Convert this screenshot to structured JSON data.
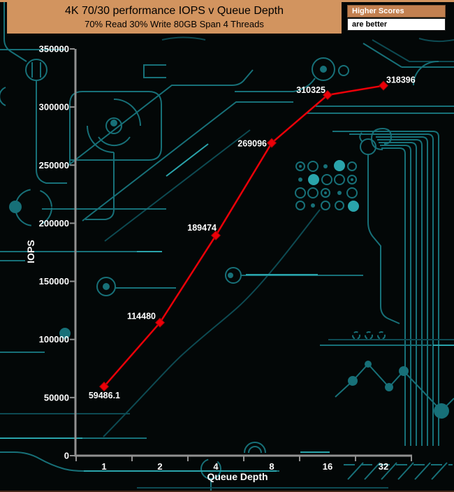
{
  "banner": {
    "title": "4K 70/30 performance IOPS v Queue Depth",
    "subtitle": "70% Read 30% Write 80GB Span 4 Threads",
    "bg_color": "#d2945f"
  },
  "note_box": {
    "header": "Higher Scores",
    "body": "are better",
    "header_bg": "#c28050",
    "body_bg": "#ffffff"
  },
  "chart_data": {
    "type": "line",
    "title": "4K 70/30 performance IOPS v Queue Depth",
    "xlabel": "Queue Depth",
    "ylabel": "IOPS",
    "categories": [
      "1",
      "2",
      "4",
      "8",
      "16",
      "32"
    ],
    "series": [
      {
        "name": "IOPS",
        "color": "#ec0008",
        "values": [
          59486.1,
          114480,
          189474,
          269096,
          310325,
          318396
        ]
      }
    ],
    "point_labels": [
      "59486.1",
      "114480",
      "189474",
      "269096",
      "310325",
      "318396"
    ],
    "yticks": [
      "0",
      "50000",
      "100000",
      "150000",
      "200000",
      "250000",
      "300000",
      "350000"
    ],
    "ylim": [
      0,
      350000
    ],
    "grid": false,
    "legend_position": "none",
    "label_offsets": [
      {
        "anchor": "end",
        "dx": 23,
        "dy": 17
      },
      {
        "anchor": "end",
        "dx": -6,
        "dy": -5
      },
      {
        "anchor": "end",
        "dx": 1,
        "dy": -7
      },
      {
        "anchor": "end",
        "dx": -7,
        "dy": 5
      },
      {
        "anchor": "end",
        "dx": -3,
        "dy": -3
      },
      {
        "anchor": "start",
        "dx": 4,
        "dy": -4
      }
    ]
  },
  "colors": {
    "background": "#030707",
    "axis": "#919191",
    "tick_label": "#ffffff",
    "line": "#ec0008",
    "marker_edge": "#a50006",
    "trace_mid": "#177078",
    "trace_bright": "#2aa4ab"
  }
}
